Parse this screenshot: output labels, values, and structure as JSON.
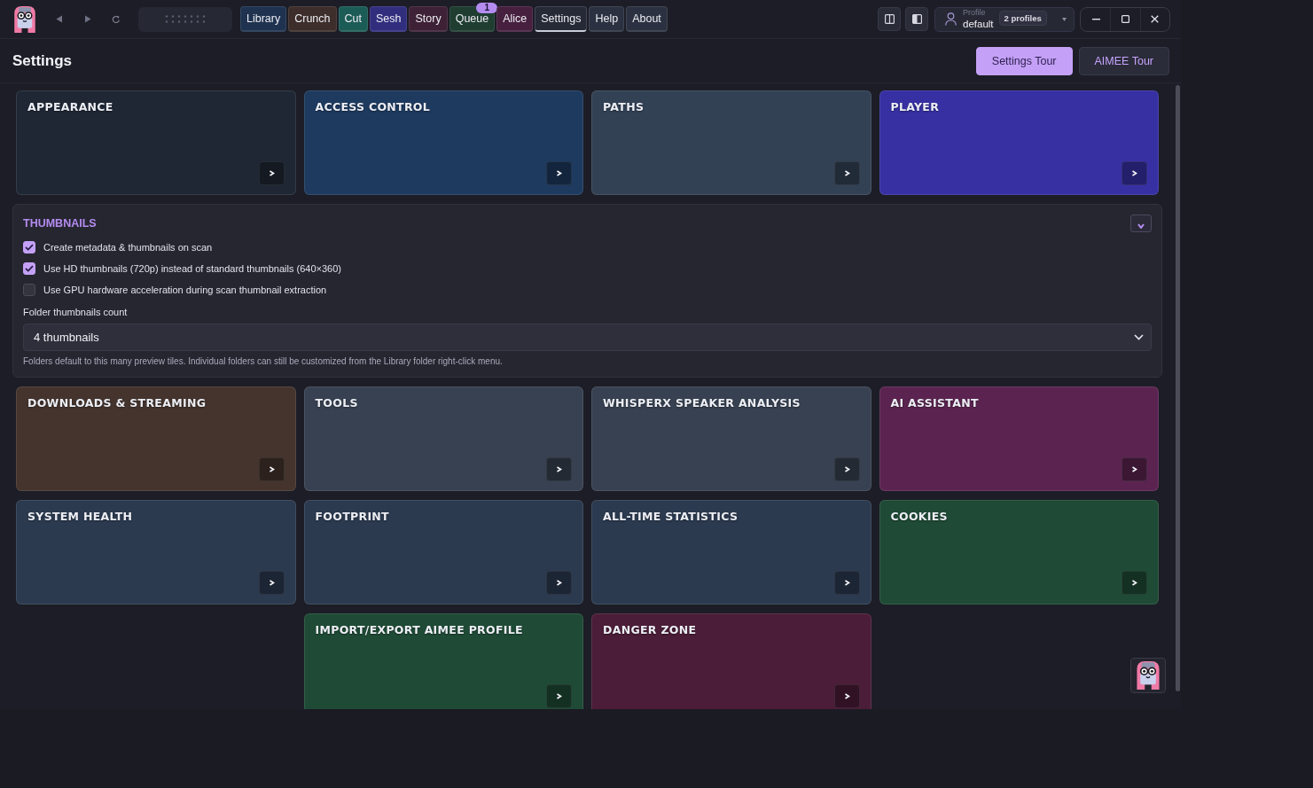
{
  "top_bar": {
    "tabs": [
      {
        "label": "Library",
        "color": "#1f3350",
        "selected": false
      },
      {
        "label": "Crunch",
        "color": "#3d2e2b",
        "selected": false
      },
      {
        "label": "Cut",
        "color": "#1c5c56",
        "selected": false
      },
      {
        "label": "Sesh",
        "color": "#322e7e",
        "selected": false
      },
      {
        "label": "Story",
        "color": "#3e2136",
        "selected": false
      },
      {
        "label": "Queue",
        "color": "#1f3d31",
        "selected": false,
        "badge": "1"
      },
      {
        "label": "Alice",
        "color": "#47203f",
        "selected": false
      },
      {
        "label": "Settings",
        "color": "#262a36",
        "selected": true
      },
      {
        "label": "Help",
        "color": "#2b3140",
        "selected": false
      },
      {
        "label": "About",
        "color": "#2b3140",
        "selected": false
      }
    ],
    "profile": {
      "label": "Profile",
      "value": "default",
      "count": "2 profiles"
    }
  },
  "header": {
    "title": "Settings",
    "buttons": [
      {
        "label": "Settings Tour",
        "kind": "primary"
      },
      {
        "label": "AIMEE Tour",
        "kind": "secondary"
      }
    ]
  },
  "sections": [
    {
      "kind": "card",
      "title": "APPEARANCE",
      "color": "#1f2735"
    },
    {
      "kind": "card",
      "title": "ACCESS CONTROL",
      "color": "#1e3a5f"
    },
    {
      "kind": "card",
      "title": "PATHS",
      "color": "#334155"
    },
    {
      "kind": "card",
      "title": "PLAYER",
      "color": "#3730a3"
    },
    {
      "kind": "panel",
      "title": "THUMBNAILS",
      "expanded": true,
      "options": [
        {
          "label": "Create metadata & thumbnails on scan",
          "checked": true
        },
        {
          "label": "Use HD thumbnails (720p) instead of standard thumbnails (640×360)",
          "checked": true
        },
        {
          "label": "Use GPU hardware acceleration during scan thumbnail extraction",
          "checked": false
        }
      ],
      "select": {
        "label": "Folder thumbnails count",
        "value": "4 thumbnails"
      },
      "hint": "Folders default to this many preview tiles. Individual folders can still be customized from the Library folder right-click menu."
    },
    {
      "kind": "card",
      "title": "DOWNLOADS & STREAMING",
      "color": "#44342d"
    },
    {
      "kind": "card",
      "title": "TOOLS",
      "color": "#374151"
    },
    {
      "kind": "card",
      "title": "WHISPERX SPEAKER ANALYSIS",
      "color": "#374151"
    },
    {
      "kind": "card",
      "title": "AI ASSISTANT",
      "color": "#5b2450"
    },
    {
      "kind": "card",
      "title": "SYSTEM HEALTH",
      "color": "#2c3a50"
    },
    {
      "kind": "card",
      "title": "FOOTPRINT",
      "color": "#2c3a50"
    },
    {
      "kind": "card",
      "title": "ALL-TIME STATISTICS",
      "color": "#2c3a50"
    },
    {
      "kind": "card",
      "title": "COOKIES",
      "color": "#1f4b36"
    },
    {
      "kind": "card",
      "title": "IMPORT/EXPORT AIMEE PROFILE",
      "color": "#1f4b36"
    },
    {
      "kind": "card",
      "title": "DANGER ZONE",
      "color": "#4c1d38"
    }
  ]
}
